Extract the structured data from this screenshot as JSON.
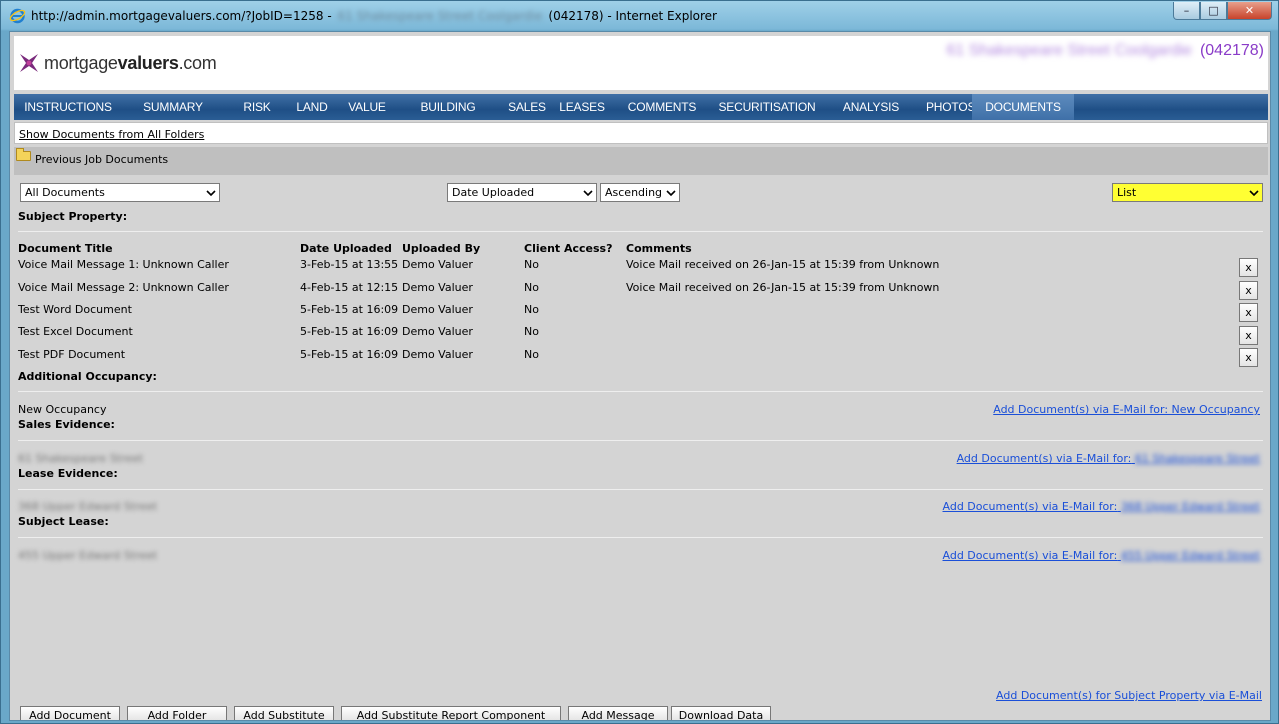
{
  "window": {
    "url": "http://admin.mortgagevaluers.com/?JobID=1258 -",
    "address_blurred": "61 Shakespeare Street Coolgardie",
    "job_code": "(042178)",
    "app": "- Internet Explorer",
    "controls": {
      "minimize": "–",
      "maximize": "□",
      "close": "✕"
    }
  },
  "header": {
    "logo_text_prefix": "mortgage",
    "logo_text_bold": "valuers",
    "logo_text_suffix": ".com",
    "address_blurred": "61 Shakespeare Street Coolgardie",
    "job_code": "(042178)"
  },
  "nav": [
    {
      "label": "INSTRUCTIONS"
    },
    {
      "label": "SUMMARY"
    },
    {
      "label": "RISK"
    },
    {
      "label": "LAND"
    },
    {
      "label": "VALUE"
    },
    {
      "label": "BUILDING"
    },
    {
      "label": "SALES"
    },
    {
      "label": "LEASES"
    },
    {
      "label": "COMMENTS"
    },
    {
      "label": "SECURITISATION"
    },
    {
      "label": "ANALYSIS"
    },
    {
      "label": "PHOTOS"
    },
    {
      "label": "DOCUMENTS",
      "active": true
    }
  ],
  "toolbar": {
    "show_all_link": "Show Documents from All Folders",
    "previous_job_docs": "Previous Job Documents",
    "filter_select": "All Documents",
    "sort_field_select": "Date Uploaded",
    "sort_order_select": "Ascending",
    "view_select": "List"
  },
  "sections": {
    "subject_property": "Subject Property:",
    "additional_occupancy": "Additional Occupancy:",
    "sales_evidence": "Sales Evidence:",
    "lease_evidence": "Lease Evidence:",
    "subject_lease": "Subject Lease:"
  },
  "table": {
    "headers": {
      "title": "Document Title",
      "date": "Date Uploaded",
      "by": "Uploaded By",
      "access": "Client Access?",
      "comments": "Comments"
    },
    "rows": [
      {
        "title": "Voice Mail Message 1: Unknown Caller",
        "date": "3-Feb-15 at 13:55",
        "by": "Demo Valuer",
        "access": "No",
        "comments": "Voice Mail received on 26-Jan-15 at 15:39 from Unknown",
        "delete": "x"
      },
      {
        "title": "Voice Mail Message 2: Unknown Caller",
        "date": "4-Feb-15 at 12:15",
        "by": "Demo Valuer",
        "access": "No",
        "comments": "Voice Mail received on 26-Jan-15 at 15:39 from Unknown",
        "delete": "x"
      },
      {
        "title": "Test Word Document",
        "date": "5-Feb-15 at 16:09",
        "by": "Demo Valuer",
        "access": "No",
        "comments": "",
        "delete": "x"
      },
      {
        "title": "Test Excel Document",
        "date": "5-Feb-15 at 16:09",
        "by": "Demo Valuer",
        "access": "No",
        "comments": "",
        "delete": "x"
      },
      {
        "title": "Test PDF Document",
        "date": "5-Feb-15 at 16:09",
        "by": "Demo Valuer",
        "access": "No",
        "comments": "",
        "delete": "x"
      }
    ]
  },
  "occupancy": {
    "item": "New Occupancy",
    "link": "Add Document(s) via E-Mail for: New Occupancy"
  },
  "sales": {
    "item_blurred": "61 Shakespeare Street",
    "link_prefix": "Add Document(s) via E-Mail for:",
    "link_blurred": "61 Shakespeare Street"
  },
  "lease": {
    "item_blurred": "368 Upper Edward Street",
    "link_prefix": "Add Document(s) via E-Mail for:",
    "link_blurred": "368 Upper Edward Street"
  },
  "subject_lease": {
    "item_blurred": "455 Upper Edward Street",
    "link_prefix": "Add Document(s) via E-Mail for:",
    "link_blurred": "455 Upper Edward Street"
  },
  "footer": {
    "subject_email_link": "Add Document(s) for Subject Property via E-Mail",
    "buttons": [
      "Add Document",
      "Add Folder",
      "Add Substitute",
      "Add Substitute Report Component",
      "Add Message",
      "Download Data"
    ]
  }
}
